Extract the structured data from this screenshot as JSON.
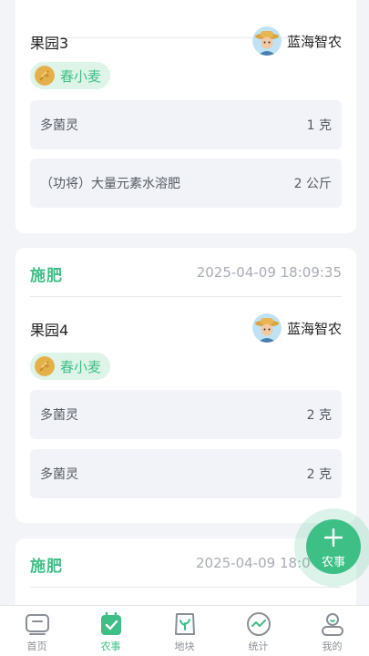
{
  "records": [
    {
      "type": "",
      "time": "",
      "plot": "果园3",
      "owner": "蓝海智农",
      "crop": "春小麦",
      "items": [
        {
          "name": "多菌灵",
          "qty": "1 克"
        },
        {
          "name": "（功将）大量元素水溶肥",
          "qty": "2 公斤"
        }
      ]
    },
    {
      "type": "施肥",
      "time": "2025-04-09 18:09:35",
      "plot": "果园4",
      "owner": "蓝海智农",
      "crop": "春小麦",
      "items": [
        {
          "name": "多菌灵",
          "qty": "2 克"
        },
        {
          "name": "多菌灵",
          "qty": "2 克"
        }
      ]
    },
    {
      "type": "施肥",
      "time": "2025-04-09 18:0",
      "plot": "",
      "owner": "",
      "crop": "",
      "items": []
    }
  ],
  "fab": {
    "label": "农事"
  },
  "tabbar": {
    "items": [
      {
        "label": "首页",
        "icon": "home-icon"
      },
      {
        "label": "农事",
        "icon": "calendar-check-icon"
      },
      {
        "label": "地块",
        "icon": "field-sprout-icon"
      },
      {
        "label": "统计",
        "icon": "chart-wave-icon"
      },
      {
        "label": "我的",
        "icon": "user-icon"
      }
    ],
    "active_index": 1
  },
  "colors": {
    "accent": "#3dbf86",
    "muted": "#a9adb4",
    "item_bg": "#f1f3f8",
    "page_bg": "#f2f4f7"
  }
}
